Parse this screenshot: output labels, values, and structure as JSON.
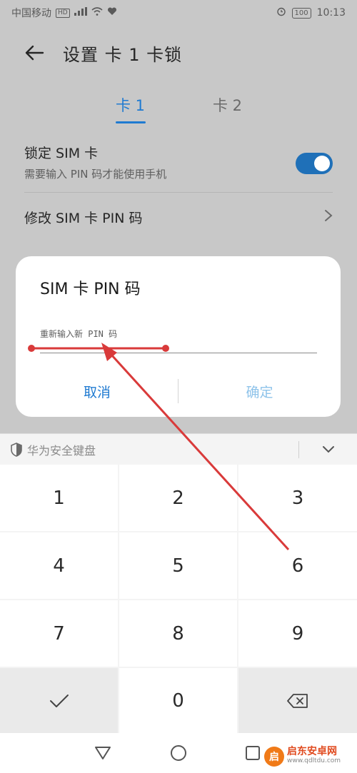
{
  "status_bar": {
    "carrier": "中国移动",
    "hd_badge": "HD",
    "signal_text": "⁴ᴳ",
    "battery": "100",
    "time": "10:13"
  },
  "header": {
    "title": "设置 卡 1 卡锁"
  },
  "tabs": [
    {
      "label": "卡 1",
      "active": true
    },
    {
      "label": "卡 2",
      "active": false
    }
  ],
  "settings": {
    "lock_sim_title": "锁定 SIM 卡",
    "lock_sim_desc": "需要输入 PIN 码才能使用手机",
    "lock_sim_enabled": true,
    "change_pin_label": "修改 SIM 卡 PIN 码"
  },
  "dialog": {
    "title": "SIM 卡 PIN 码",
    "input_placeholder": "重新输入新 PIN 码",
    "cancel_label": "取消",
    "confirm_label": "确定"
  },
  "keyboard": {
    "label": "华为安全键盘",
    "keys": [
      "1",
      "2",
      "3",
      "4",
      "5",
      "6",
      "7",
      "8",
      "9",
      "0"
    ]
  },
  "watermark": {
    "logo_text": "启",
    "title": "启东安卓网",
    "url": "www.qdltdu.com"
  },
  "colors": {
    "accent": "#1f7ad1",
    "annotation": "#d93a3a"
  }
}
